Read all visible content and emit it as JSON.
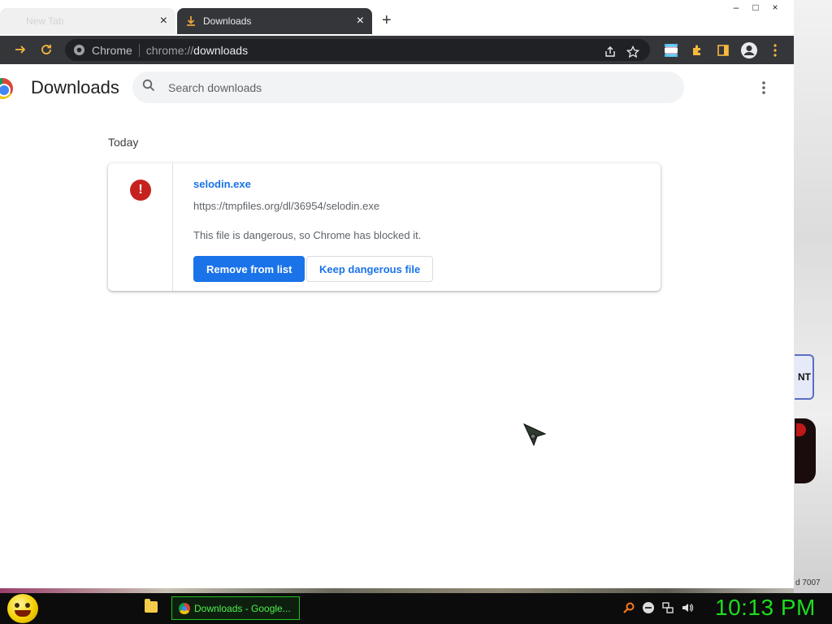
{
  "browser": {
    "tabs": [
      {
        "title": "New Tab",
        "active": false
      },
      {
        "title": "Downloads",
        "active": true
      }
    ],
    "omnibox": {
      "site_label": "Chrome",
      "url_scheme": "chrome://",
      "url_path": "downloads"
    },
    "icons": {
      "back": "back-arrow-icon",
      "reload": "reload-icon",
      "share": "share-icon",
      "bookmark": "star-icon",
      "extensions": "puzzle-icon",
      "side_panel": "side-panel-icon",
      "profile": "avatar-icon",
      "menu": "kebab-menu-icon"
    }
  },
  "downloads": {
    "page_title": "Downloads",
    "search_placeholder": "Search downloads",
    "date_group": "Today",
    "items": [
      {
        "filename": "selodin.exe",
        "url": "https://tmpfiles.org/dl/36954/selodin.exe",
        "status": "This file is dangerous, so Chrome has blocked it.",
        "icon": "danger-icon",
        "primary_action": "Remove from list",
        "secondary_action": "Keep dangerous file"
      }
    ]
  },
  "desktop": {
    "badge_text": "NT",
    "tiny_text": "d 7007"
  },
  "taskbar": {
    "task_label": "Downloads - Google...",
    "clock": "10:13 PM"
  },
  "colors": {
    "accent": "#1a73e8",
    "danger": "#c5221f",
    "toolbar": "#35363a",
    "clock": "#1edc1e"
  }
}
